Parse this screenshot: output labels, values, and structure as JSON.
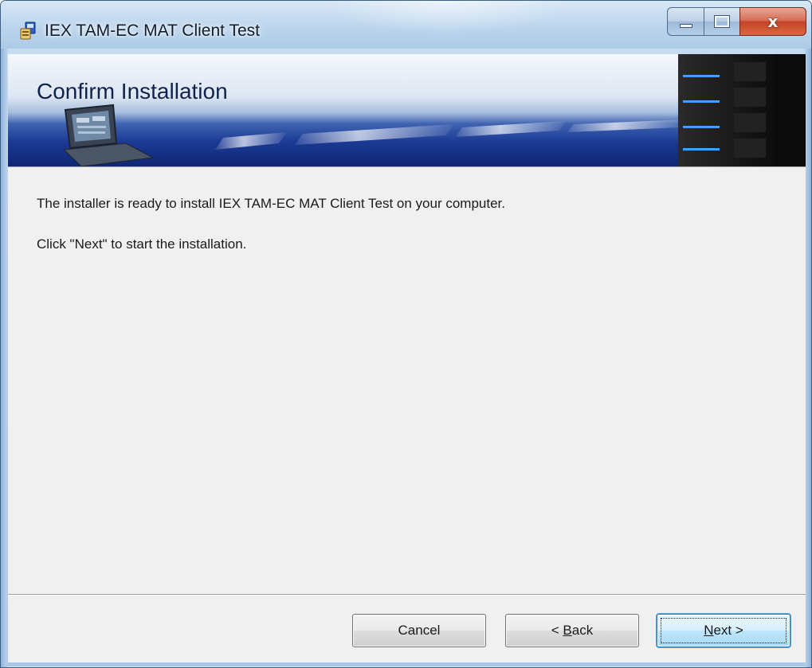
{
  "window": {
    "title": "IEX TAM-EC MAT Client Test",
    "close_glyph": "x"
  },
  "banner": {
    "title": "Confirm Installation"
  },
  "content": {
    "line1": "The installer is ready to install IEX TAM-EC MAT Client Test on your computer.",
    "line2": "Click \"Next\" to start the installation."
  },
  "buttons": {
    "cancel": "Cancel",
    "back": {
      "prefix": "< ",
      "accel": "B",
      "rest": "ack"
    },
    "next": {
      "accel": "N",
      "rest": "ext >"
    }
  },
  "icons": {
    "app": "installer-icon",
    "minimize": "minimize-icon",
    "maximize": "maximize-icon",
    "close": "close-icon"
  },
  "colors": {
    "banner_dark": "#0f2676",
    "content_bg": "#f0f0f0",
    "close_red": "#c44428",
    "default_button_border": "#3c7fb1"
  }
}
